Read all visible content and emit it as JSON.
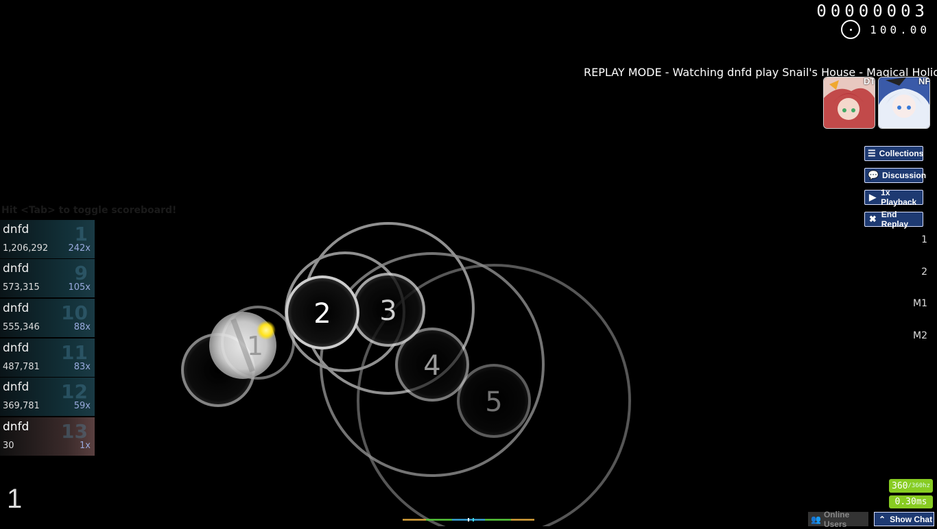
{
  "hud": {
    "score": "00000003",
    "accuracy": "100.00",
    "replay_text": "REPLAY MODE - Watching dnfd play Snail's House - Magical Holic"
  },
  "mods": [
    {
      "label": "DT",
      "icon": "double-time-mod-icon"
    },
    {
      "label": "NF",
      "icon": "no-fail-mod-icon"
    }
  ],
  "buttons": {
    "collections": "Collections",
    "discussion": "Discussion",
    "playback": "1x Playback",
    "end_replay": "End Replay"
  },
  "keys": [
    "1",
    "2",
    "M1",
    "M2"
  ],
  "scoreboard": {
    "hint": "Hit <Tab> to toggle scoreboard!",
    "entries": [
      {
        "name": "dnfd",
        "score": "1,206,292",
        "combo": "242x",
        "rank": "1"
      },
      {
        "name": "dnfd",
        "score": "573,315",
        "combo": "105x",
        "rank": "9"
      },
      {
        "name": "dnfd",
        "score": "555,346",
        "combo": "88x",
        "rank": "10"
      },
      {
        "name": "dnfd",
        "score": "487,781",
        "combo": "83x",
        "rank": "11"
      },
      {
        "name": "dnfd",
        "score": "369,781",
        "combo": "59x",
        "rank": "12"
      },
      {
        "name": "dnfd",
        "score": "30",
        "combo": "1x",
        "rank": "13"
      }
    ]
  },
  "combo": "1",
  "playfield": {
    "circles": [
      "1",
      "2",
      "3",
      "4",
      "5"
    ]
  },
  "perf": {
    "fps": "360",
    "fps_max": "/360hz",
    "latency": "0.30ms"
  },
  "bottom": {
    "online_users": "Online Users",
    "show_chat": "Show Chat"
  },
  "colors": {
    "button_bg": "#1e3a72",
    "perf_green": "#88cc22",
    "cursor": "#ffee22"
  }
}
